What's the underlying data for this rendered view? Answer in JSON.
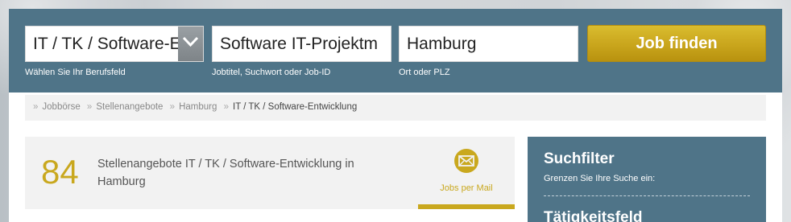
{
  "search": {
    "profession_value": "IT / TK / Software-Entwicklung",
    "profession_hint": "Wählen Sie Ihr Berufsfeld",
    "keyword_value": "Software IT-Projektm",
    "keyword_hint": "Jobtitel, Suchwort oder Job-ID",
    "location_value": "Hamburg",
    "location_hint": "Ort oder PLZ",
    "submit_label": "Job finden"
  },
  "breadcrumb": {
    "items": [
      "Jobbörse",
      "Stellenangebote",
      "Hamburg"
    ],
    "current": "IT / TK / Software-Entwicklung"
  },
  "results": {
    "count": "84",
    "text": "Stellenangebote IT / TK / Software-Entwicklung in Hamburg",
    "mail_label": "Jobs per Mail"
  },
  "filter": {
    "title": "Suchfilter",
    "subtitle": "Grenzen Sie Ihre Suche ein:",
    "section_title": "Tätigkeitsfeld"
  },
  "colors": {
    "panel_blue": "#4f7488",
    "accent_gold": "#c9a81e"
  },
  "icons": {
    "select_arrow": "chevron-down-icon",
    "mail": "envelope-icon"
  }
}
